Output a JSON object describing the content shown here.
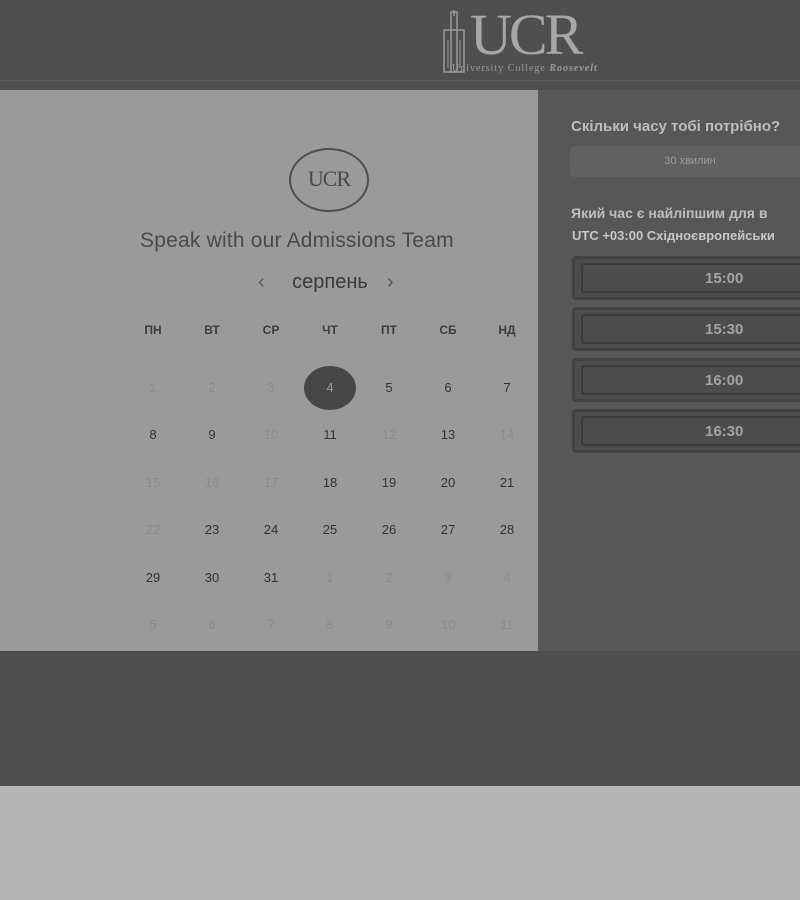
{
  "header": {
    "logo_letters": "UCR",
    "logo_subtitle_prefix": "University College",
    "logo_subtitle_name": "Roosevelt"
  },
  "booking": {
    "badge_letters": "UCR",
    "title": "Speak with our Admissions Team",
    "month": "серпень",
    "weekdays": [
      "ПН",
      "ВТ",
      "СР",
      "ЧТ",
      "ПТ",
      "СБ",
      "НД"
    ],
    "selected_day": "4",
    "weeks": [
      [
        {
          "d": "1",
          "dim": true
        },
        {
          "d": "2",
          "dim": true
        },
        {
          "d": "3",
          "dim": true
        },
        {
          "d": "4",
          "dim": false
        },
        {
          "d": "5",
          "dim": false
        },
        {
          "d": "6",
          "dim": false
        },
        {
          "d": "7",
          "dim": false
        }
      ],
      [
        {
          "d": "8",
          "dim": false
        },
        {
          "d": "9",
          "dim": false
        },
        {
          "d": "10",
          "dim": true
        },
        {
          "d": "11",
          "dim": false
        },
        {
          "d": "12",
          "dim": true
        },
        {
          "d": "13",
          "dim": false
        },
        {
          "d": "14",
          "dim": true
        }
      ],
      [
        {
          "d": "15",
          "dim": true
        },
        {
          "d": "16",
          "dim": true
        },
        {
          "d": "17",
          "dim": true
        },
        {
          "d": "18",
          "dim": false
        },
        {
          "d": "19",
          "dim": false
        },
        {
          "d": "20",
          "dim": false
        },
        {
          "d": "21",
          "dim": false
        }
      ],
      [
        {
          "d": "22",
          "dim": true
        },
        {
          "d": "23",
          "dim": false
        },
        {
          "d": "24",
          "dim": false
        },
        {
          "d": "25",
          "dim": false
        },
        {
          "d": "26",
          "dim": false
        },
        {
          "d": "27",
          "dim": false
        },
        {
          "d": "28",
          "dim": false
        }
      ],
      [
        {
          "d": "29",
          "dim": false
        },
        {
          "d": "30",
          "dim": false
        },
        {
          "d": "31",
          "dim": false
        },
        {
          "d": "1",
          "dim": true
        },
        {
          "d": "2",
          "dim": true
        },
        {
          "d": "3",
          "dim": true
        },
        {
          "d": "4",
          "dim": true
        }
      ],
      [
        {
          "d": "5",
          "dim": true
        },
        {
          "d": "6",
          "dim": true
        },
        {
          "d": "7",
          "dim": true
        },
        {
          "d": "8",
          "dim": true
        },
        {
          "d": "9",
          "dim": true
        },
        {
          "d": "10",
          "dim": true
        },
        {
          "d": "11",
          "dim": true
        }
      ]
    ]
  },
  "sidebar": {
    "duration_question": "Скільки часу тобі потрібно?",
    "duration_value": "30 хвилин",
    "time_question": "Який час є найліпшим для в",
    "timezone": "UTC +03:00 Східноєвропейськи",
    "slots": [
      "15:00",
      "15:30",
      "16:00",
      "16:30"
    ]
  },
  "icons": {
    "prev": "chevron-left-icon",
    "next": "chevron-right-icon",
    "logo": "tower-logo-icon"
  }
}
